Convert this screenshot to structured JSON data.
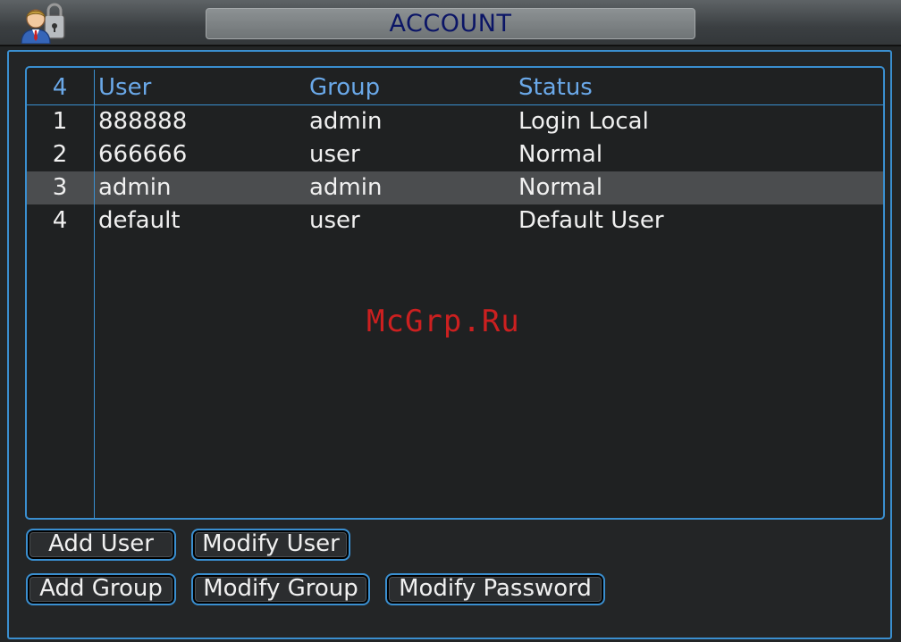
{
  "window": {
    "title": "ACCOUNT",
    "icon": "user-account-lock-icon"
  },
  "table": {
    "headers": {
      "num": "4",
      "user": "User",
      "group": "Group",
      "status": "Status"
    },
    "rows": [
      {
        "num": "1",
        "user": "888888",
        "group": "admin",
        "status": "Login Local"
      },
      {
        "num": "2",
        "user": "666666",
        "group": "user",
        "status": "Normal"
      },
      {
        "num": "3",
        "user": "admin",
        "group": "admin",
        "status": "Normal"
      },
      {
        "num": "4",
        "user": "default",
        "group": "user",
        "status": "Default User"
      }
    ],
    "selected_row": 3
  },
  "buttons": {
    "add_user": "Add User",
    "modify_user": "Modify User",
    "add_group": "Add Group",
    "modify_group": "Modify Group",
    "modify_password": "Modify Password"
  },
  "watermark": "McGrp.Ru",
  "colors": {
    "accent": "#3a8fd0",
    "header_text": "#6aa8e8",
    "title_text": "#0b1566",
    "selected_row": "#4b4d4f",
    "watermark": "#cc2020"
  }
}
